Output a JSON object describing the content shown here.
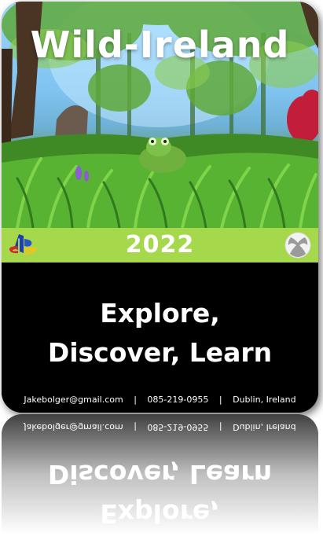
{
  "poster": {
    "title": "Wild-Ireland",
    "year": "2022",
    "tagline_line1": "Explore,",
    "tagline_line2": "Discover, Learn",
    "contact": {
      "email": "Jakebolger@gmail.com",
      "separator": "|",
      "phone": "085-219-0955",
      "location": "Dublin, Ireland"
    }
  },
  "icons": {
    "left_platform": "playstation-icon",
    "right_platform": "xbox-icon"
  },
  "colors": {
    "year_band": "#a6d84b",
    "panel": "#000000",
    "text": "#ffffff"
  }
}
